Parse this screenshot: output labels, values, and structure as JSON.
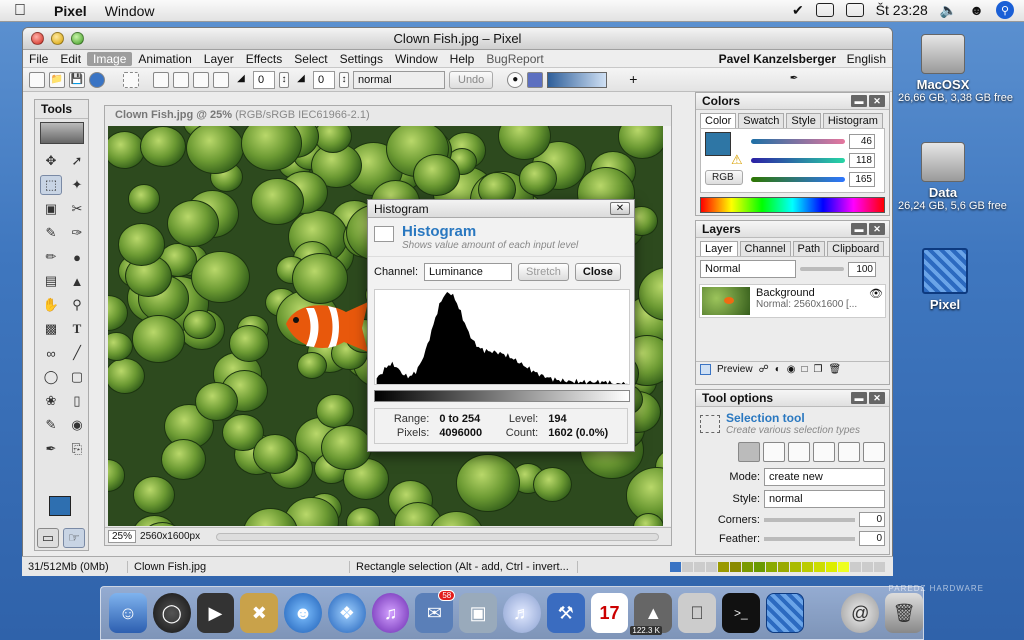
{
  "menubar": {
    "app_name": "Pixel",
    "window_menu": "Window",
    "clock": "Št 23:28"
  },
  "desktop": {
    "macosx": {
      "name": "MacOSX",
      "sub": "26,66 GB, 3,38 GB free"
    },
    "data": {
      "name": "Data",
      "sub": "26,24 GB, 5,6 GB free"
    },
    "pixel": {
      "name": "Pixel"
    }
  },
  "window": {
    "title": "Clown Fish.jpg – Pixel",
    "menus": [
      "File",
      "Edit",
      "Image",
      "Animation",
      "Layer",
      "Effects",
      "Select",
      "Settings",
      "Window",
      "Help",
      "BugReport"
    ],
    "active_menu": "Image",
    "user": "Pavel Kanzelsberger",
    "language": "English"
  },
  "toolbar": {
    "field1": "0",
    "field2": "0",
    "blend_mode": "normal",
    "undo_label": "Undo"
  },
  "tools": {
    "title": "Tools",
    "fg_color": "#2e6fb0"
  },
  "document": {
    "title": "Clown Fish.jpg @ 25%",
    "color_info": "(RGB/sRGB IEC61966-2.1)",
    "zoom": "25%",
    "size": "2560x1600px"
  },
  "histogram": {
    "window_title": "Histogram",
    "heading": "Histogram",
    "subheading": "Shows value amount of each input level",
    "channel_label": "Channel:",
    "channel_value": "Luminance",
    "stretch_label": "Stretch",
    "close_label": "Close",
    "range_label": "Range:",
    "range_value": "0 to 254",
    "level_label": "Level:",
    "level_value": "194",
    "pixels_label": "Pixels:",
    "pixels_value": "4096000",
    "count_label": "Count:",
    "count_value": "1602 (0.0%)"
  },
  "colors_panel": {
    "title": "Colors",
    "tabs": [
      "Color",
      "Swatch",
      "Style",
      "Histogram"
    ],
    "active_tab": "Color",
    "r": "46",
    "g": "118",
    "b": "165",
    "mode_button": "RGB",
    "swatch": "#2e76a5"
  },
  "layers_panel": {
    "title": "Layers",
    "tabs": [
      "Layer",
      "Channel",
      "Path",
      "Clipboard"
    ],
    "active_tab": "Layer",
    "blend_mode": "normal_cap",
    "blend_mode_label": "Normal",
    "opacity": "100",
    "layer_name": "Background",
    "layer_info": "Normal: 2560x1600 [...",
    "preview_label": "Preview"
  },
  "tool_options": {
    "title": "Tool options",
    "tool_name": "Selection tool",
    "tool_desc": "Create various selection types",
    "mode_label": "Mode:",
    "mode_value": "create new",
    "style_label": "Style:",
    "style_value": "normal",
    "corners_label": "Corners:",
    "corners_value": "0",
    "feather_label": "Feather:",
    "feather_value": "0"
  },
  "statusbar": {
    "memory": "31/512Mb (0Mb)",
    "filename": "Clown Fish.jpg",
    "hint": "Rectangle selection (Alt - add, Ctrl - invert..."
  },
  "dock": {
    "mail_badge": "58",
    "calendar_day": "17",
    "net_rate": "122.3 K"
  },
  "watermark": "PAREDZ HARDWARE"
}
